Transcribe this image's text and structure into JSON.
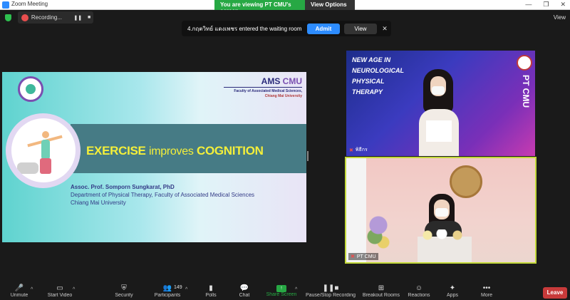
{
  "window": {
    "title": "Zoom Meeting",
    "controls": [
      "—",
      "❐",
      "✕"
    ]
  },
  "banner": {
    "viewing_text": "You are viewing PT CMU's screen",
    "view_options_label": "View Options ⌄"
  },
  "recording": {
    "label": "Recording...",
    "pause_icon": "pause-icon",
    "stop_icon": "stop-icon",
    "pause_glyph": "❚❚",
    "stop_glyph": "■"
  },
  "top_view_label": "View",
  "waiting_room": {
    "message": "4.กฤตวิทย์ แดงเพชร entered the waiting room",
    "admit_label": "Admit",
    "view_label": "View",
    "close_glyph": "✕"
  },
  "slide": {
    "ams": "AMS",
    "cmu": "CMU",
    "faculty_line": "Faculty of Associated Medical Sciences,",
    "university_line": "Chiang Mai University",
    "heading_exercise": "EXERCISE",
    "heading_improves": "improves",
    "heading_cognition": "COGNITION",
    "presenter": "Assoc. Prof. Somporn Sungkarat, PhD",
    "department": "Department of Physical Therapy, Faculty of Associated Medical Sciences",
    "university": "Chiang Mai University",
    "colors": {
      "heading": "#f4ef3a",
      "band": "#467b85",
      "text": "#333a86"
    }
  },
  "participants": {
    "tile1": {
      "banner_title": "NEW AGE IN NEUROLOGICAL PHYSICAL THERAPY",
      "side_text": "PT CMU",
      "name": "พิธีกร",
      "mic_icon": "mic-muted-icon"
    },
    "tile2": {
      "name": "PT CMU",
      "mic_icon": "mic-muted-icon",
      "active_speaker_color": "#c3d93a"
    }
  },
  "toolbar": {
    "unmute": "Unmute",
    "start_video": "Start Video",
    "security": "Security",
    "participants": "Participants",
    "participants_count": "149",
    "polls": "Polls",
    "chat": "Chat",
    "share_screen": "Share Screen",
    "pause_stop_recording": "Pause/Stop Recording",
    "breakout_rooms": "Breakout Rooms",
    "reactions": "Reactions",
    "apps": "Apps",
    "more": "More",
    "leave": "Leave",
    "caret": "^",
    "glyphs": {
      "unmute": "🎤",
      "start_video": "▭",
      "security": "⛨",
      "participants": "👥",
      "polls": "▮",
      "chat": "💬",
      "share_screen": "↑",
      "pause_stop_recording": "❚❚■",
      "breakout_rooms": "⊞",
      "reactions": "☺",
      "apps": "✦",
      "more": "•••"
    },
    "colors": {
      "share": "#27a844",
      "leave": "#c83a3a"
    }
  }
}
